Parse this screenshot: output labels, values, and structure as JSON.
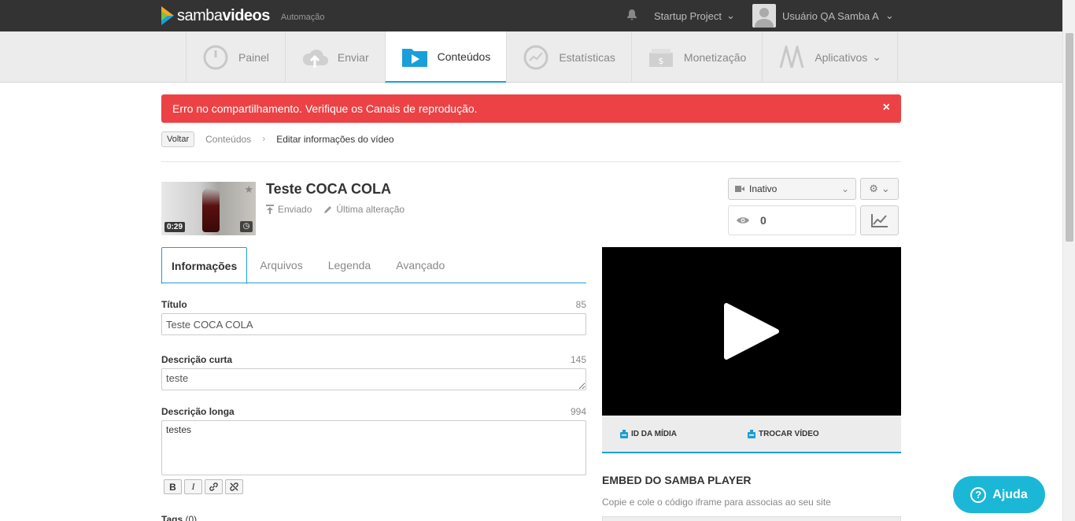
{
  "app": {
    "logo_prefix": "samba",
    "logo_suffix": "videos",
    "environment": "Automação"
  },
  "topbar": {
    "project": "Startup Project",
    "user": "Usuário QA Samba A"
  },
  "nav": [
    {
      "label": "Painel",
      "icon": "dashboard-icon"
    },
    {
      "label": "Enviar",
      "icon": "upload-cloud-icon"
    },
    {
      "label": "Conteúdos",
      "icon": "folder-play-icon",
      "active": true
    },
    {
      "label": "Estatísticas",
      "icon": "stats-icon"
    },
    {
      "label": "Monetização",
      "icon": "money-icon"
    },
    {
      "label": "Aplicativos",
      "icon": "apps-icon"
    }
  ],
  "alert": {
    "message": "Erro no compartilhamento. Verifique os Canais de reprodução.",
    "close": "×",
    "color": "#ec4245"
  },
  "breadcrumb": {
    "back": "Voltar",
    "parent": "Conteúdos",
    "current": "Editar informações do vídeo"
  },
  "video": {
    "title": "Teste COCA COLA",
    "duration": "0:29",
    "meta_sent": "Enviado",
    "meta_changed": "Última alteração",
    "status": "Inativo",
    "views": "0"
  },
  "tabs": [
    "Informações",
    "Arquivos",
    "Legenda",
    "Avançado"
  ],
  "form": {
    "title_label": "Título",
    "title_count": "85",
    "title_value": "Teste COCA COLA",
    "short_label": "Descrição curta",
    "short_count": "145",
    "short_value": "teste",
    "long_label": "Descrição longa",
    "long_count": "994",
    "long_value": "testes",
    "tags_label": "Tags",
    "tags_count": "(0)"
  },
  "toolbar": {
    "bold": "B",
    "italic": "I"
  },
  "player": {
    "media_id": "ID DA MÍDIA",
    "swap_video": "TROCAR VÍDEO",
    "embed_title": "EMBED DO SAMBA PLAYER",
    "embed_desc": "Copie e cole o código iframe para associas ao seu site"
  },
  "help": {
    "label": "Ajuda",
    "symbol": "?"
  },
  "colors": {
    "accent": "#1a9fd9",
    "topbar": "#333333",
    "help": "#1bb7d6"
  }
}
